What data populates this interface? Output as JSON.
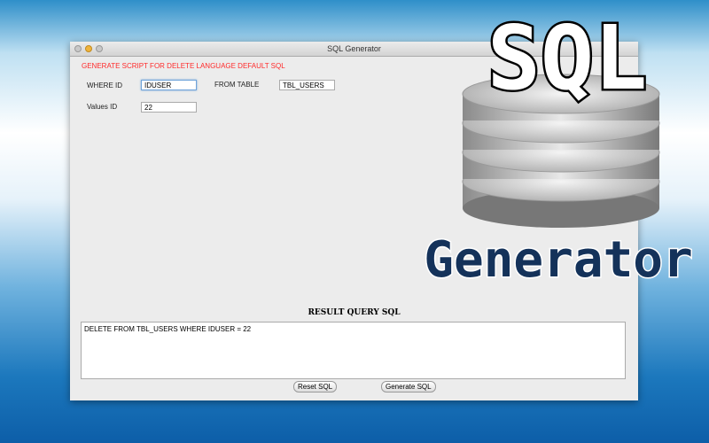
{
  "window": {
    "title": "SQL Generator"
  },
  "form": {
    "heading": "GENERATE SCRIPT FOR DELETE LANGUAGE DEFAULT SQL",
    "where_id_label": "WHERE ID",
    "where_id_value": "IDUSER",
    "from_table_label": "FROM TABLE",
    "from_table_value": "TBL_USERS",
    "values_id_label": "Values ID",
    "values_id_value": "22"
  },
  "result": {
    "title": "RESULT QUERY SQL",
    "text": "DELETE FROM TBL_USERS WHERE IDUSER = 22"
  },
  "buttons": {
    "reset": "Reset SQL",
    "generate": "Generate SQL"
  },
  "logo": {
    "top_text": "SQL",
    "bottom_text": "Generator",
    "icon": "database-stack-icon"
  }
}
